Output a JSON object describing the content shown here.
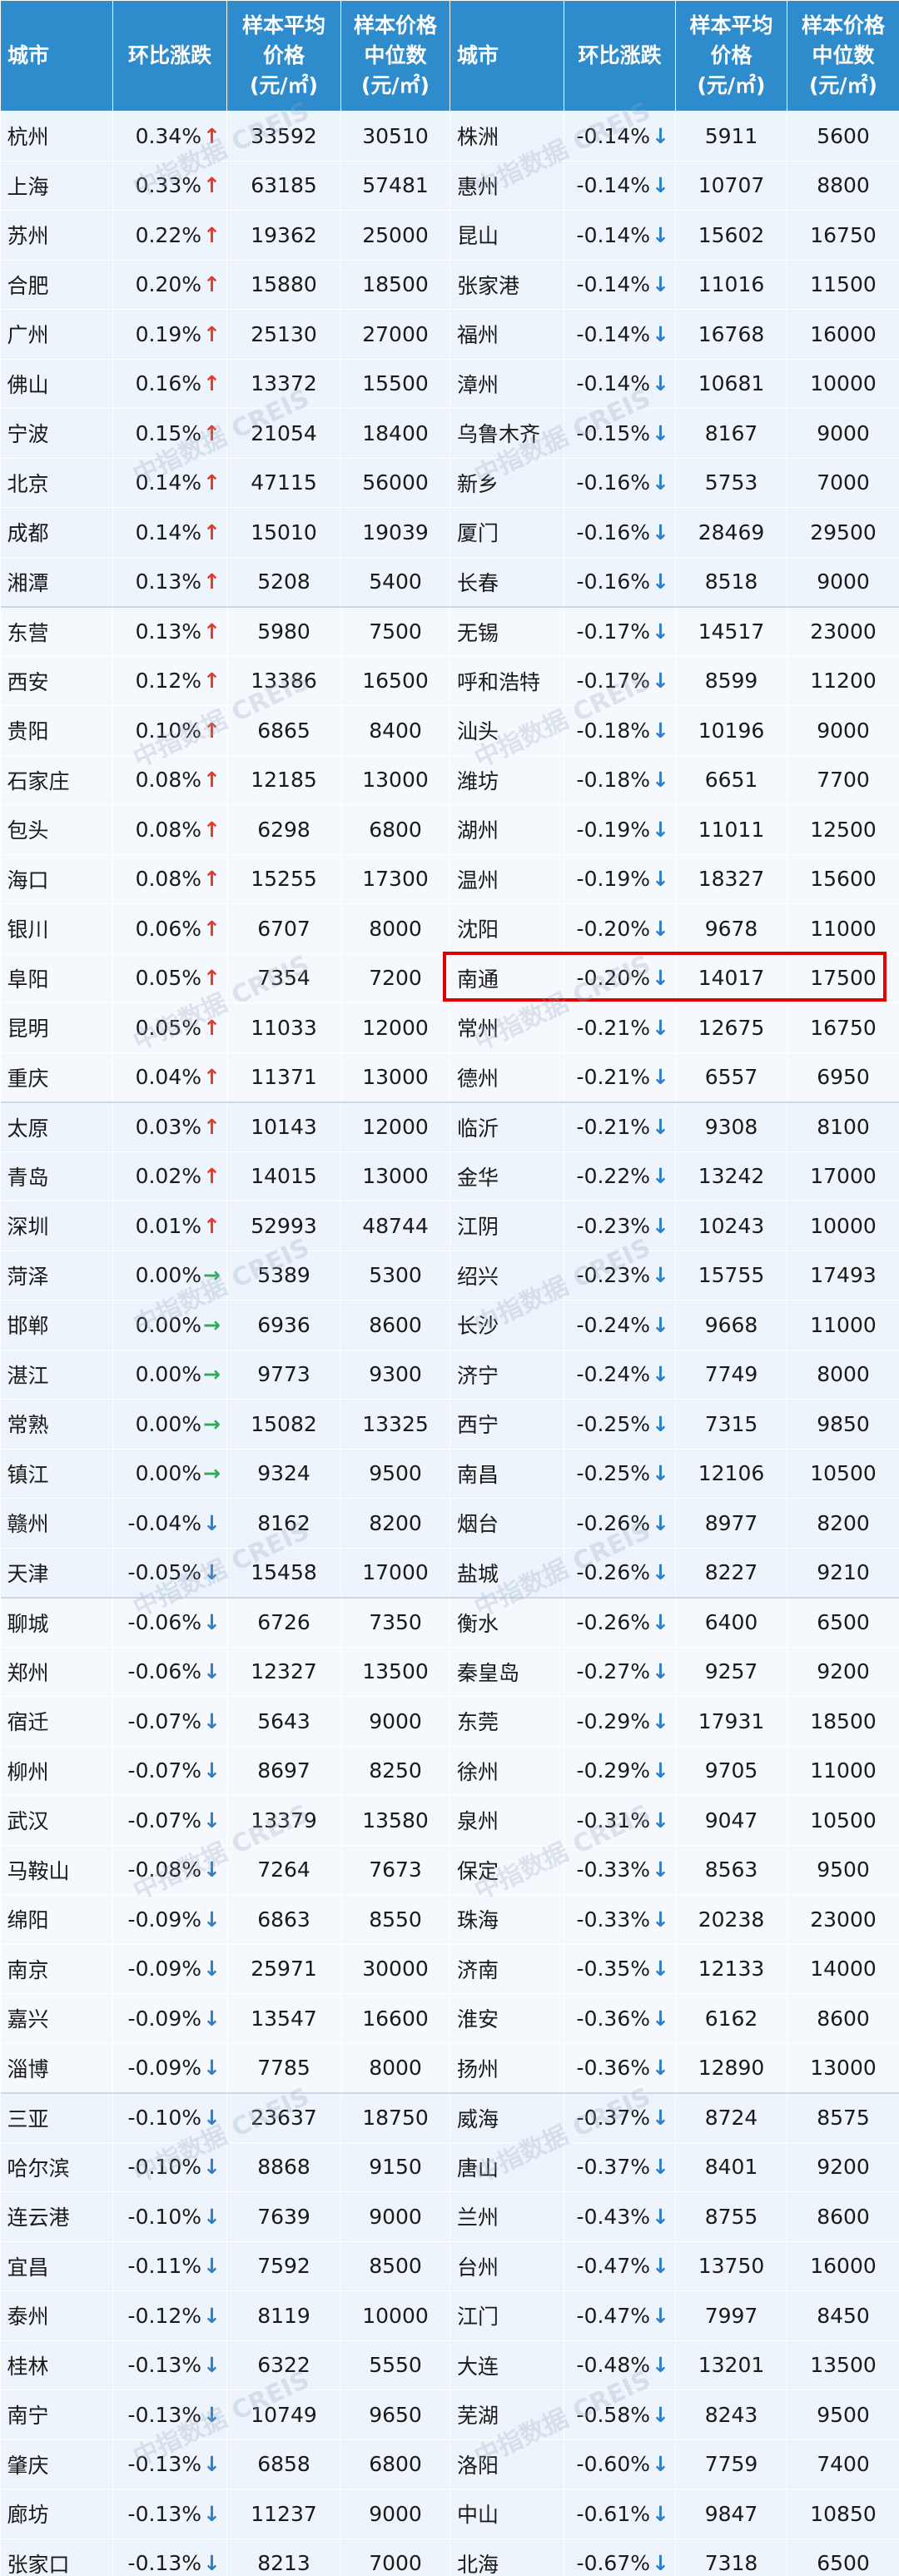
{
  "header": {
    "city": "城市",
    "change": "环比涨跌",
    "avg_l1": "样本平均",
    "avg_l2": "价格",
    "avg_unit": "(元/㎡)",
    "med_l1": "样本价格",
    "med_l2": "中位数",
    "med_unit": "(元/㎡)"
  },
  "watermark": "中指数据 CREIS",
  "icons": {
    "up": "up-arrow-icon",
    "down": "down-arrow-icon",
    "flat": "right-arrow-icon"
  },
  "colors": {
    "header_bg": "#2e8bcc",
    "up": "#e23a2e",
    "down": "#2e7fc8",
    "flat": "#2eaa55",
    "highlight": "#e00000"
  },
  "highlight_row": 17,
  "rows": [
    [
      "杭州",
      "0.34%",
      "up",
      "33592",
      "30510",
      "株洲",
      "-0.14%",
      "down",
      "5911",
      "5600"
    ],
    [
      "上海",
      "0.33%",
      "up",
      "63185",
      "57481",
      "惠州",
      "-0.14%",
      "down",
      "10707",
      "8800"
    ],
    [
      "苏州",
      "0.22%",
      "up",
      "19362",
      "25000",
      "昆山",
      "-0.14%",
      "down",
      "15602",
      "16750"
    ],
    [
      "合肥",
      "0.20%",
      "up",
      "15880",
      "18500",
      "张家港",
      "-0.14%",
      "down",
      "11016",
      "11500"
    ],
    [
      "广州",
      "0.19%",
      "up",
      "25130",
      "27000",
      "福州",
      "-0.14%",
      "down",
      "16768",
      "16000"
    ],
    [
      "佛山",
      "0.16%",
      "up",
      "13372",
      "15500",
      "漳州",
      "-0.14%",
      "down",
      "10681",
      "10000"
    ],
    [
      "宁波",
      "0.15%",
      "up",
      "21054",
      "18400",
      "乌鲁木齐",
      "-0.15%",
      "down",
      "8167",
      "9000"
    ],
    [
      "北京",
      "0.14%",
      "up",
      "47115",
      "56000",
      "新乡",
      "-0.16%",
      "down",
      "5753",
      "7000"
    ],
    [
      "成都",
      "0.14%",
      "up",
      "15010",
      "19039",
      "厦门",
      "-0.16%",
      "down",
      "28469",
      "29500"
    ],
    [
      "湘潭",
      "0.13%",
      "up",
      "5208",
      "5400",
      "长春",
      "-0.16%",
      "down",
      "8518",
      "9000"
    ],
    [
      "东营",
      "0.13%",
      "up",
      "5980",
      "7500",
      "无锡",
      "-0.17%",
      "down",
      "14517",
      "23000"
    ],
    [
      "西安",
      "0.12%",
      "up",
      "13386",
      "16500",
      "呼和浩特",
      "-0.17%",
      "down",
      "8599",
      "11200"
    ],
    [
      "贵阳",
      "0.10%",
      "up",
      "6865",
      "8400",
      "汕头",
      "-0.18%",
      "down",
      "10196",
      "9000"
    ],
    [
      "石家庄",
      "0.08%",
      "up",
      "12185",
      "13000",
      "潍坊",
      "-0.18%",
      "down",
      "6651",
      "7700"
    ],
    [
      "包头",
      "0.08%",
      "up",
      "6298",
      "6800",
      "湖州",
      "-0.19%",
      "down",
      "11011",
      "12500"
    ],
    [
      "海口",
      "0.08%",
      "up",
      "15255",
      "17300",
      "温州",
      "-0.19%",
      "down",
      "18327",
      "15600"
    ],
    [
      "银川",
      "0.06%",
      "up",
      "6707",
      "8000",
      "沈阳",
      "-0.20%",
      "down",
      "9678",
      "11000"
    ],
    [
      "阜阳",
      "0.05%",
      "up",
      "7354",
      "7200",
      "南通",
      "-0.20%",
      "down",
      "14017",
      "17500"
    ],
    [
      "昆明",
      "0.05%",
      "up",
      "11033",
      "12000",
      "常州",
      "-0.21%",
      "down",
      "12675",
      "16750"
    ],
    [
      "重庆",
      "0.04%",
      "up",
      "11371",
      "13000",
      "德州",
      "-0.21%",
      "down",
      "6557",
      "6950"
    ],
    [
      "太原",
      "0.03%",
      "up",
      "10143",
      "12000",
      "临沂",
      "-0.21%",
      "down",
      "9308",
      "8100"
    ],
    [
      "青岛",
      "0.02%",
      "up",
      "14015",
      "13000",
      "金华",
      "-0.22%",
      "down",
      "13242",
      "17000"
    ],
    [
      "深圳",
      "0.01%",
      "up",
      "52993",
      "48744",
      "江阴",
      "-0.23%",
      "down",
      "10243",
      "10000"
    ],
    [
      "菏泽",
      "0.00%",
      "flat",
      "5389",
      "5300",
      "绍兴",
      "-0.23%",
      "down",
      "15755",
      "17493"
    ],
    [
      "邯郸",
      "0.00%",
      "flat",
      "6936",
      "8600",
      "长沙",
      "-0.24%",
      "down",
      "9668",
      "11000"
    ],
    [
      "湛江",
      "0.00%",
      "flat",
      "9773",
      "9300",
      "济宁",
      "-0.24%",
      "down",
      "7749",
      "8000"
    ],
    [
      "常熟",
      "0.00%",
      "flat",
      "15082",
      "13325",
      "西宁",
      "-0.25%",
      "down",
      "7315",
      "9850"
    ],
    [
      "镇江",
      "0.00%",
      "flat",
      "9324",
      "9500",
      "南昌",
      "-0.25%",
      "down",
      "12106",
      "10500"
    ],
    [
      "赣州",
      "-0.04%",
      "down",
      "8162",
      "8200",
      "烟台",
      "-0.26%",
      "down",
      "8977",
      "8200"
    ],
    [
      "天津",
      "-0.05%",
      "down",
      "15458",
      "17000",
      "盐城",
      "-0.26%",
      "down",
      "8227",
      "9210"
    ],
    [
      "聊城",
      "-0.06%",
      "down",
      "6726",
      "7350",
      "衡水",
      "-0.26%",
      "down",
      "6400",
      "6500"
    ],
    [
      "郑州",
      "-0.06%",
      "down",
      "12327",
      "13500",
      "秦皇岛",
      "-0.27%",
      "down",
      "9257",
      "9200"
    ],
    [
      "宿迁",
      "-0.07%",
      "down",
      "5643",
      "9000",
      "东莞",
      "-0.29%",
      "down",
      "17931",
      "18500"
    ],
    [
      "柳州",
      "-0.07%",
      "down",
      "8697",
      "8250",
      "徐州",
      "-0.29%",
      "down",
      "9705",
      "11000"
    ],
    [
      "武汉",
      "-0.07%",
      "down",
      "13379",
      "13580",
      "泉州",
      "-0.31%",
      "down",
      "9047",
      "10500"
    ],
    [
      "马鞍山",
      "-0.08%",
      "down",
      "7264",
      "7673",
      "保定",
      "-0.33%",
      "down",
      "8563",
      "9500"
    ],
    [
      "绵阳",
      "-0.09%",
      "down",
      "6863",
      "8550",
      "珠海",
      "-0.33%",
      "down",
      "20238",
      "23000"
    ],
    [
      "南京",
      "-0.09%",
      "down",
      "25971",
      "30000",
      "济南",
      "-0.35%",
      "down",
      "12133",
      "14000"
    ],
    [
      "嘉兴",
      "-0.09%",
      "down",
      "13547",
      "16600",
      "淮安",
      "-0.36%",
      "down",
      "6162",
      "8600"
    ],
    [
      "淄博",
      "-0.09%",
      "down",
      "7785",
      "8000",
      "扬州",
      "-0.36%",
      "down",
      "12890",
      "13000"
    ],
    [
      "三亚",
      "-0.10%",
      "down",
      "23637",
      "18750",
      "威海",
      "-0.37%",
      "down",
      "8724",
      "8575"
    ],
    [
      "哈尔滨",
      "-0.10%",
      "down",
      "8868",
      "9150",
      "唐山",
      "-0.37%",
      "down",
      "8401",
      "9200"
    ],
    [
      "连云港",
      "-0.10%",
      "down",
      "7639",
      "9000",
      "兰州",
      "-0.43%",
      "down",
      "8755",
      "8600"
    ],
    [
      "宜昌",
      "-0.11%",
      "down",
      "7592",
      "8500",
      "台州",
      "-0.47%",
      "down",
      "13750",
      "16000"
    ],
    [
      "泰州",
      "-0.12%",
      "down",
      "8119",
      "10000",
      "江门",
      "-0.47%",
      "down",
      "7997",
      "8450"
    ],
    [
      "桂林",
      "-0.13%",
      "down",
      "6322",
      "5550",
      "大连",
      "-0.48%",
      "down",
      "13201",
      "13500"
    ],
    [
      "南宁",
      "-0.13%",
      "down",
      "10749",
      "9650",
      "芜湖",
      "-0.58%",
      "down",
      "8243",
      "9500"
    ],
    [
      "肇庆",
      "-0.13%",
      "down",
      "6858",
      "6800",
      "洛阳",
      "-0.60%",
      "down",
      "7759",
      "7400"
    ],
    [
      "廊坊",
      "-0.13%",
      "down",
      "11237",
      "9000",
      "中山",
      "-0.61%",
      "down",
      "9847",
      "10850"
    ],
    [
      "张家口",
      "-0.13%",
      "down",
      "8213",
      "7000",
      "北海",
      "-0.67%",
      "down",
      "7318",
      "6500"
    ]
  ]
}
